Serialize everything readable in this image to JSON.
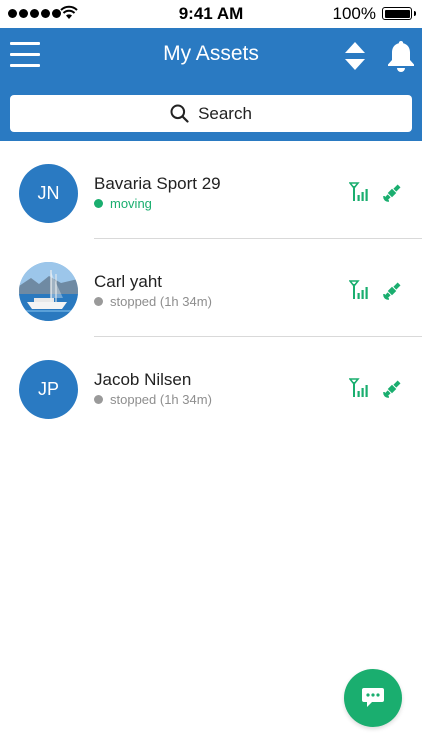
{
  "status_bar": {
    "time": "9:41 AM",
    "battery_percent": "100%"
  },
  "header": {
    "title": "My Assets",
    "background_color": "#2a7ac2",
    "menu_icon": "hamburger-icon",
    "sort_icon": "sort-arrows-icon",
    "notification_icon": "bell-icon"
  },
  "search": {
    "label": "Search",
    "icon": "search-icon"
  },
  "assets": [
    {
      "initials": "JN",
      "name": "Bavaria Sport 29",
      "status": "moving",
      "status_color": "#1aae6f"
    },
    {
      "initials": "",
      "avatar_type": "photo",
      "name": "Carl yaht",
      "status": "stopped (1h 34m)",
      "status_color": "#9a9a9a"
    },
    {
      "initials": "JP",
      "name": "Jacob Nilsen",
      "status": "stopped (1h 34m)",
      "status_color": "#9a9a9a"
    }
  ],
  "row_icons": {
    "signal": "cellular-signal-icon",
    "gps": "satellite-icon",
    "color": "#1aae6f"
  },
  "fab": {
    "icon": "chat-icon",
    "color": "#1aae6f"
  }
}
